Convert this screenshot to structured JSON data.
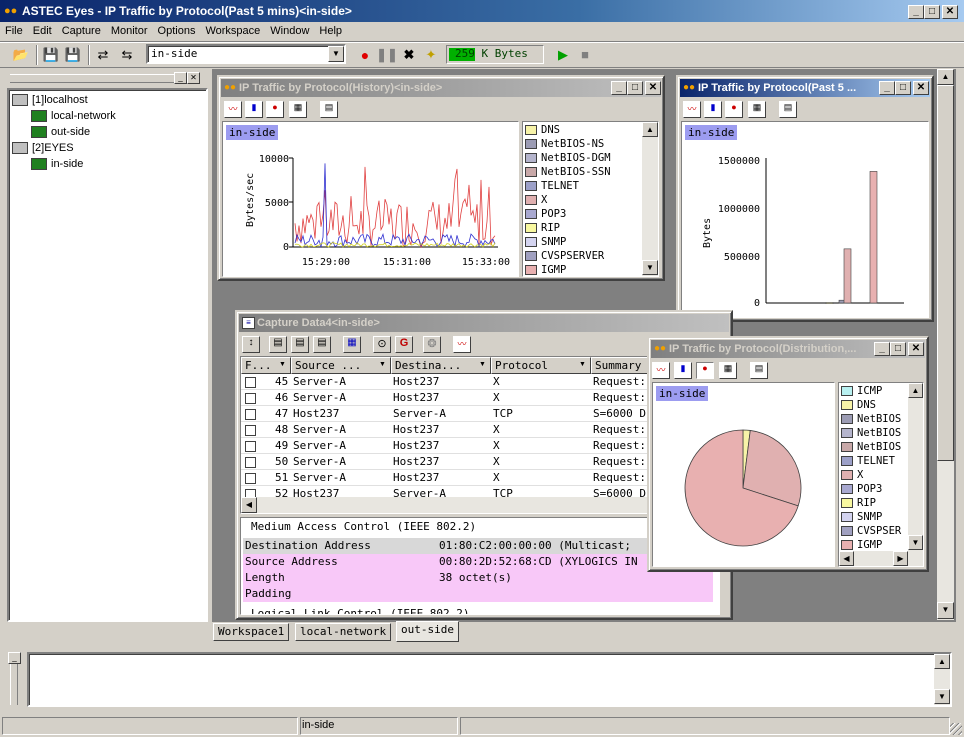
{
  "app": {
    "title": "ASTEC Eyes - IP Traffic by Protocol(Past 5 mins)<in-side>"
  },
  "menu": [
    "File",
    "Edit",
    "Capture",
    "Monitor",
    "Options",
    "Workspace",
    "Window",
    "Help"
  ],
  "toolbar": {
    "interface_select": "in-side",
    "counter": "259 K Bytes"
  },
  "tree": {
    "items": [
      "[1]localhost",
      "local-network",
      "out-side",
      "[2]EYES",
      "in-side"
    ]
  },
  "history": {
    "title": "IP Traffic by Protocol(History)<in-side>",
    "chip": "in-side",
    "ylabel": "Bytes/sec",
    "yticks": [
      "10000",
      "5000",
      "0"
    ],
    "xticks": [
      "15:29:00",
      "15:31:00",
      "15:33:00"
    ]
  },
  "legend_colors": {
    "DNS": "#f7f3a8",
    "NetBIOS-NS": "#9c9cb4",
    "NetBIOS-DGM": "#b4b4cc",
    "NetBIOS-SSN": "#c8a8a8",
    "TELNET": "#9ca0c8",
    "X": "#e0b0b0",
    "POP3": "#a8a8d0",
    "RIP": "#f8f8a0",
    "SNMP": "#d4d4f0",
    "CVSPSERVER": "#a0a0c0",
    "IGMP": "#e8b0b0",
    "ICMP": "#b8f0f0"
  },
  "history_legend": [
    "DNS",
    "NetBIOS-NS",
    "NetBIOS-DGM",
    "NetBIOS-SSN",
    "TELNET",
    "X",
    "POP3",
    "RIP",
    "SNMP",
    "CVSPSERVER",
    "IGMP"
  ],
  "past5": {
    "title": "IP Traffic by Protocol(Past 5 ...",
    "chip": "in-side",
    "ylabel": "Bytes",
    "yticks": [
      "1500000",
      "1000000",
      "500000",
      "0"
    ]
  },
  "chart_data": [
    {
      "type": "bar",
      "title": "",
      "ylabel": "Bytes",
      "ylim": [
        0,
        1600000
      ],
      "categories": [
        "DNS",
        "NetBIOS-NS",
        "X",
        "IGMP"
      ],
      "values": [
        5000,
        30000,
        580000,
        1410000
      ]
    },
    {
      "type": "pie",
      "categories": [
        "DNS",
        "X",
        "IGMP"
      ],
      "values": [
        0.02,
        0.28,
        0.7
      ]
    }
  ],
  "capture": {
    "title": "Capture Data4<in-side>",
    "columns": [
      "F...",
      "Source ...",
      "Destina...",
      "Protocol",
      "Summary"
    ],
    "rows": [
      {
        "no": "45",
        "src": "Server-A",
        "dst": "Host237",
        "proto": "X",
        "sum": "Request:"
      },
      {
        "no": "46",
        "src": "Server-A",
        "dst": "Host237",
        "proto": "X",
        "sum": "Request:"
      },
      {
        "no": "47",
        "src": "Host237",
        "dst": "Server-A",
        "proto": "TCP",
        "sum": "S=6000 D"
      },
      {
        "no": "48",
        "src": "Server-A",
        "dst": "Host237",
        "proto": "X",
        "sum": "Request:"
      },
      {
        "no": "49",
        "src": "Server-A",
        "dst": "Host237",
        "proto": "X",
        "sum": "Request:"
      },
      {
        "no": "50",
        "src": "Server-A",
        "dst": "Host237",
        "proto": "X",
        "sum": "Request:"
      },
      {
        "no": "51",
        "src": "Server-A",
        "dst": "Host237",
        "proto": "X",
        "sum": "Request:"
      },
      {
        "no": "52",
        "src": "Host237",
        "dst": "Server-A",
        "proto": "TCP",
        "sum": "S=6000 D"
      }
    ],
    "detail_header": "Medium Access Control (IEEE 802.2)",
    "details": [
      {
        "field": "Destination Address",
        "value": "01:80:C2:00:00:00 (Multicast;"
      },
      {
        "field": "Source Address",
        "value": "00:80:2D:52:68:CD (XYLOGICS IN"
      },
      {
        "field": "Length",
        "value": "38 octet(s)"
      },
      {
        "field": "Padding",
        "value": ""
      }
    ],
    "detail_footer": "Logical Link Control (IEEE 802.2)"
  },
  "dist": {
    "title": "IP Traffic by Protocol(Distribution,...",
    "chip": "in-side",
    "legend": [
      "ICMP",
      "DNS",
      "NetBIOS",
      "NetBIOS",
      "NetBIOS",
      "TELNET",
      "X",
      "POP3",
      "RIP",
      "SNMP",
      "CVSPSER",
      "IGMP"
    ],
    "legend_keys": [
      "ICMP",
      "DNS",
      "NetBIOS-NS",
      "NetBIOS-DGM",
      "NetBIOS-SSN",
      "TELNET",
      "X",
      "POP3",
      "RIP",
      "SNMP",
      "CVSPSERVER",
      "IGMP"
    ]
  },
  "tabs": [
    "Workspace1",
    "local-network",
    "out-side"
  ],
  "status": {
    "interface": "in-side"
  }
}
